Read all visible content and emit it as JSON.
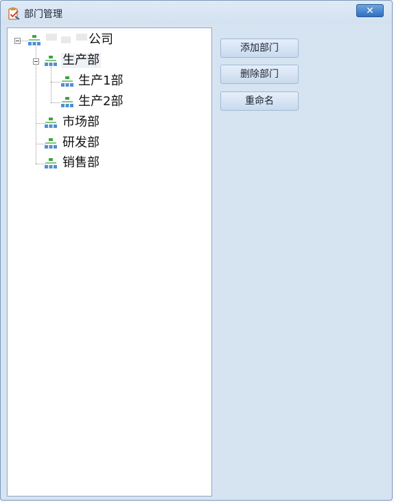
{
  "dialog": {
    "title": "部门管理",
    "close_label": "✕",
    "app_icon": "clipboard-check-icon"
  },
  "tree": {
    "root": {
      "label": "公司",
      "expanded": true,
      "icon": "org-chart-icon"
    },
    "nodes": [
      {
        "label": "生产部",
        "expanded": true,
        "selected": true,
        "icon": "org-chart-icon",
        "children": [
          {
            "label": "生产1部",
            "icon": "org-chart-icon"
          },
          {
            "label": "生产2部",
            "icon": "org-chart-icon"
          }
        ]
      },
      {
        "label": "市场部",
        "icon": "org-chart-icon"
      },
      {
        "label": "研发部",
        "icon": "org-chart-icon"
      },
      {
        "label": "销售部",
        "icon": "org-chart-icon"
      }
    ]
  },
  "actions": {
    "add_label": "添加部门",
    "delete_label": "删除部门",
    "rename_label": "重命名"
  },
  "colors": {
    "dialog_bg": "#d6e3f1",
    "close_btn": "#2f6fc0",
    "tree_bg": "#ffffff"
  }
}
